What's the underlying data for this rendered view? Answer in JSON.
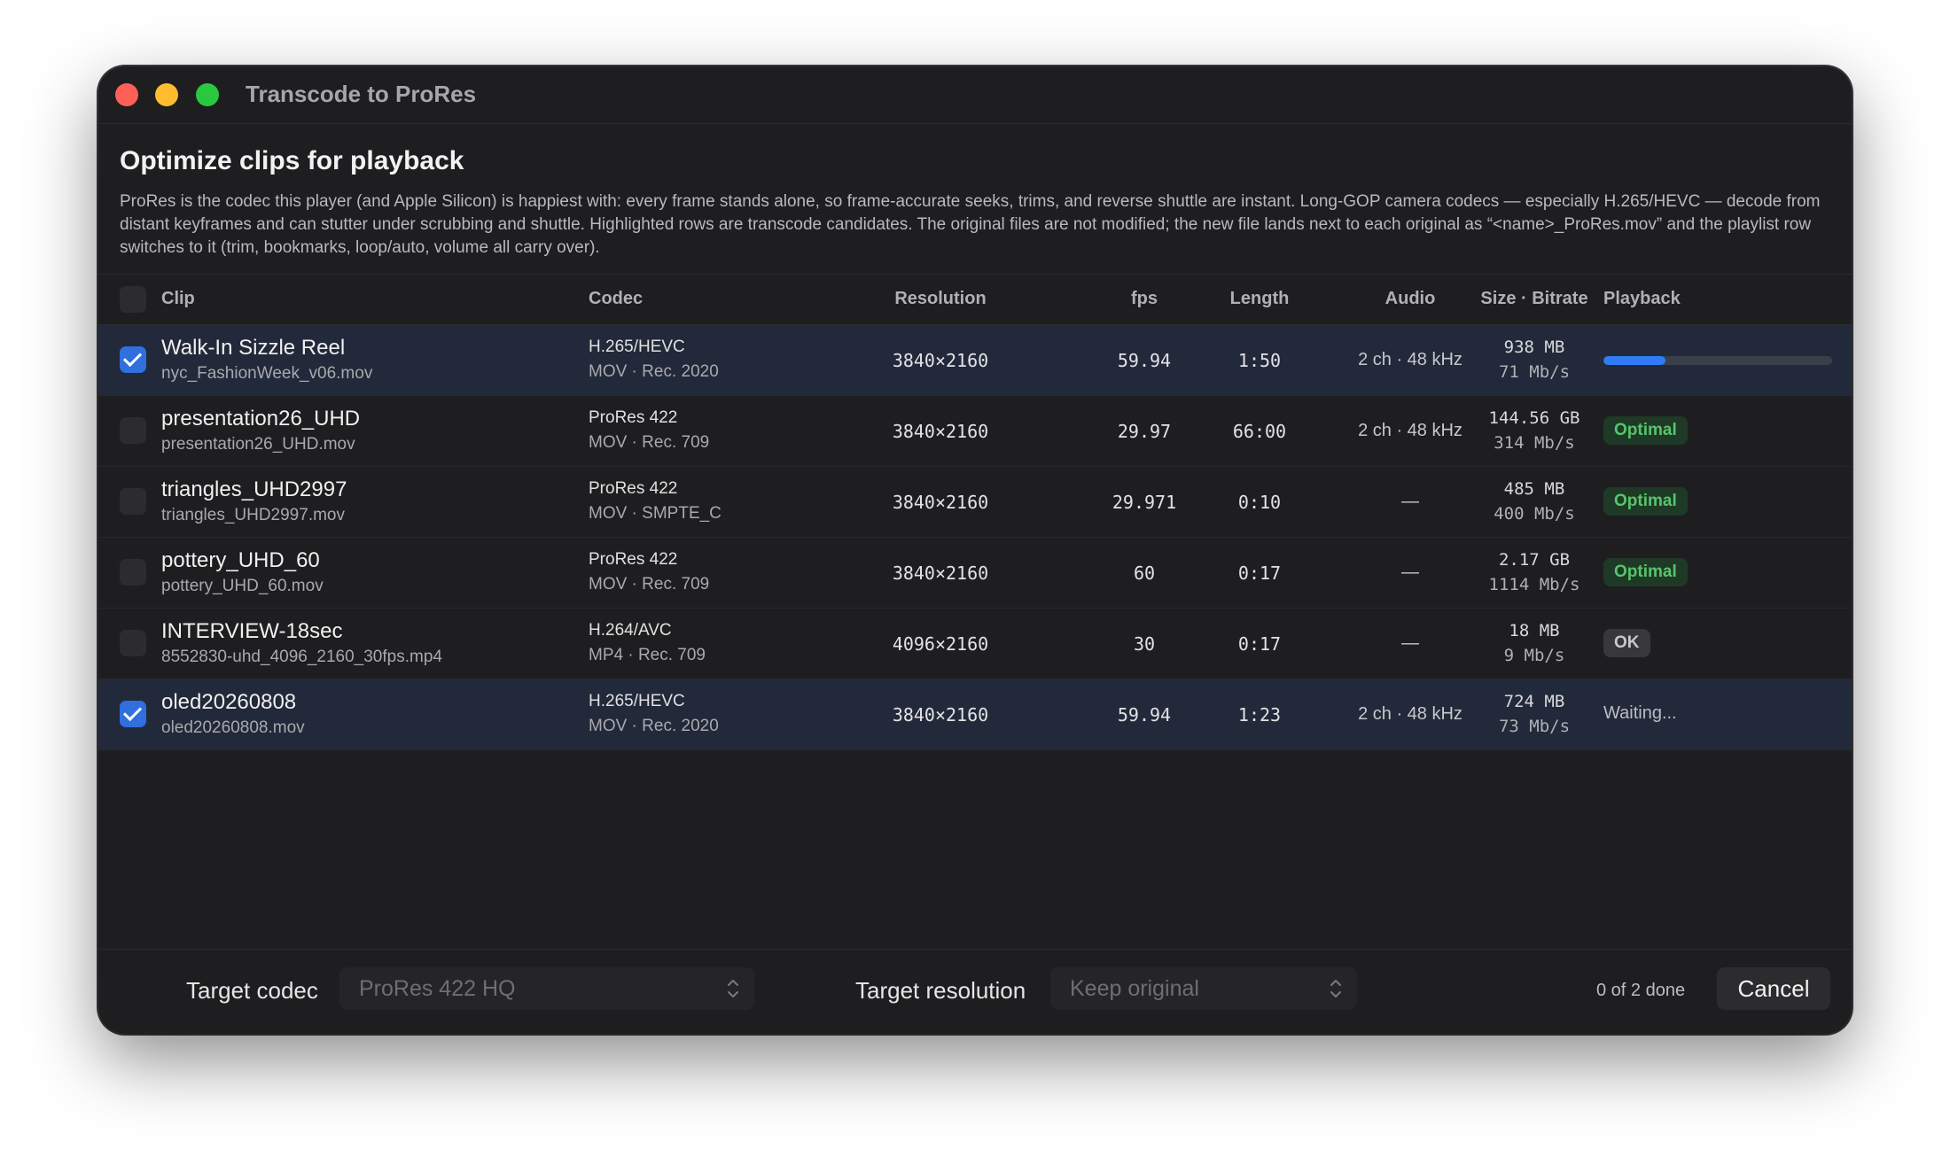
{
  "window": {
    "title": "Transcode to ProRes"
  },
  "header": {
    "title": "Optimize clips for playback",
    "description": "ProRes is the codec this player (and Apple Silicon) is happiest with: every frame stands alone, so frame-accurate seeks, trims, and reverse shuttle are instant. Long-GOP camera codecs — especially H.265/HEVC — decode from distant keyframes and can stutter under scrubbing and shuttle. Highlighted rows are transcode candidates. The original files are not modified; the new file lands next to each original as “<name>_ProRes.mov” and the playlist row switches to it (trim, bookmarks, loop/auto, volume all carry over)."
  },
  "columns": {
    "clip": "Clip",
    "codec": "Codec",
    "resolution": "Resolution",
    "fps": "fps",
    "length": "Length",
    "audio": "Audio",
    "size": "Size · Bitrate",
    "playback": "Playback"
  },
  "rows": [
    {
      "name": "Walk-In Sizzle Reel",
      "file": "nyc_FashionWeek_v06.mov",
      "codec": "H.265/HEVC",
      "container": "MOV · Rec. 2020",
      "resolution": "3840×2160",
      "fps": "59.94",
      "length": "1:50",
      "audio": "2 ch · 48 kHz",
      "size": "938 MB",
      "bitrate": "71 Mb/s",
      "checked": true,
      "highlighted": true,
      "playback_type": "progress",
      "progress": 0.27
    },
    {
      "name": "presentation26_UHD",
      "file": "presentation26_UHD.mov",
      "codec": "ProRes 422",
      "container": "MOV · Rec. 709",
      "resolution": "3840×2160",
      "fps": "29.97",
      "length": "66:00",
      "audio": "2 ch · 48 kHz",
      "size": "144.56 GB",
      "bitrate": "314 Mb/s",
      "checked": false,
      "highlighted": false,
      "playback_type": "optimal",
      "playback": "Optimal"
    },
    {
      "name": "triangles_UHD2997",
      "file": "triangles_UHD2997.mov",
      "codec": "ProRes 422",
      "container": "MOV · SMPTE_C",
      "resolution": "3840×2160",
      "fps": "29.971",
      "length": "0:10",
      "audio": "—",
      "size": "485 MB",
      "bitrate": "400 Mb/s",
      "checked": false,
      "highlighted": false,
      "playback_type": "optimal",
      "playback": "Optimal"
    },
    {
      "name": "pottery_UHD_60",
      "file": "pottery_UHD_60.mov",
      "codec": "ProRes 422",
      "container": "MOV · Rec. 709",
      "resolution": "3840×2160",
      "fps": "60",
      "length": "0:17",
      "audio": "—",
      "size": "2.17 GB",
      "bitrate": "1114 Mb/s",
      "checked": false,
      "highlighted": false,
      "playback_type": "optimal",
      "playback": "Optimal"
    },
    {
      "name": "INTERVIEW-18sec",
      "file": "8552830-uhd_4096_2160_30fps.mp4",
      "codec": "H.264/AVC",
      "container": "MP4 · Rec. 709",
      "resolution": "4096×2160",
      "fps": "30",
      "length": "0:17",
      "audio": "—",
      "size": "18 MB",
      "bitrate": "9 Mb/s",
      "checked": false,
      "highlighted": false,
      "playback_type": "ok",
      "playback": "OK"
    },
    {
      "name": "oled20260808",
      "file": "oled20260808.mov",
      "codec": "H.265/HEVC",
      "container": "MOV · Rec. 2020",
      "resolution": "3840×2160",
      "fps": "59.94",
      "length": "1:23",
      "audio": "2 ch · 48 kHz",
      "size": "724 MB",
      "bitrate": "73 Mb/s",
      "checked": true,
      "highlighted": true,
      "playback_type": "text",
      "playback": "Waiting..."
    }
  ],
  "footer": {
    "codec_label": "Target codec",
    "codec_value": "ProRes 422 HQ",
    "resolution_label": "Target resolution",
    "resolution_value": "Keep original",
    "status": "0 of 2 done",
    "cancel_label": "Cancel"
  },
  "colors": {
    "accent": "#2f7cf6",
    "optimal_text": "#57c46c",
    "optimal_bg": "#1e3a26",
    "highlight_row": "#22293a",
    "window_bg": "#1e1e20"
  }
}
